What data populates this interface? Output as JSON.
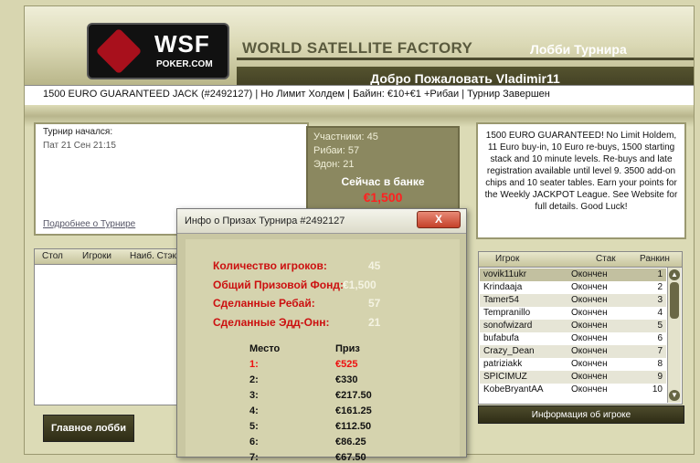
{
  "header": {
    "logo_text": "WSF",
    "logo_sub": "POKER.COM",
    "factory_title": "WORLD SATELLITE FACTORY",
    "lobby_title": "Лобби Турнира",
    "welcome": "Добро Пожаловать Vladimir11"
  },
  "tournament_info": "1500 EURO GUARANTEED JACK (#2492127)  |  Но Лимит Холдем  |  Байин: €10+€1 +Рибаи  |  Турнир Завершен",
  "start_panel": {
    "label": "Турнир начался:",
    "datetime": "Пат 21 Сен 21:15",
    "more_link": "Подробнее о Турнире"
  },
  "stats_panel": {
    "participants": "Участники: 45",
    "rebuys": "Рибаи: 57",
    "addons": "Эдон: 21",
    "pot_label": "Сейчас в банке",
    "pot_value": "€1,500"
  },
  "description": "1500 EURO GUARANTEED! No Limit Holdem, 11 Euro buy-in, 10 Euro re-buys, 1500 starting stack and 10 minute levels. Re-buys and late registration available until level 9. 3500 add-on chips and 10 seater tables. Earn your points for the Weekly JACKPOT League. See Website for full details. Good Luck!",
  "tables_header": {
    "table": "Стол",
    "players": "Игроки",
    "largest": "Наиб. Стэк"
  },
  "players_header": {
    "player": "Игрок",
    "stack": "Стак",
    "rank": "Ранкин"
  },
  "players": [
    {
      "name": "vovik11ukr",
      "status": "Окончен",
      "rank": "1"
    },
    {
      "name": "Krindaaja",
      "status": "Окончен",
      "rank": "2"
    },
    {
      "name": "Tamer54",
      "status": "Окончен",
      "rank": "3"
    },
    {
      "name": "Tempranillo",
      "status": "Окончен",
      "rank": "4"
    },
    {
      "name": "sonofwizard",
      "status": "Окончен",
      "rank": "5"
    },
    {
      "name": "bufabufa",
      "status": "Окончен",
      "rank": "6"
    },
    {
      "name": "Crazy_Dean",
      "status": "Окончен",
      "rank": "7"
    },
    {
      "name": "patriziakk",
      "status": "Окончен",
      "rank": "8"
    },
    {
      "name": "SPICIMUZ",
      "status": "Окончен",
      "rank": "9"
    },
    {
      "name": "KobeBryantAA",
      "status": "Окончен",
      "rank": "10"
    }
  ],
  "buttons": {
    "main_lobby": "Главное лобби",
    "player_info": "Информация об игроке"
  },
  "dialog": {
    "title": "Инфо о Призах Турнира #2492127",
    "close": "X",
    "stats": [
      {
        "label": "Количество игроков:",
        "value": "45"
      },
      {
        "label": "Общий Призовой Фонд:",
        "value": "€1,500"
      },
      {
        "label": "Сделанные Ребай:",
        "value": "57"
      },
      {
        "label": "Сделанные Эдд-Онн:",
        "value": "21"
      }
    ],
    "place_header": "Место",
    "prize_header": "Приз",
    "prizes": [
      {
        "place": "1:",
        "prize": "€525"
      },
      {
        "place": "2:",
        "prize": "€330"
      },
      {
        "place": "3:",
        "prize": "€217.50"
      },
      {
        "place": "4:",
        "prize": "€161.25"
      },
      {
        "place": "5:",
        "prize": "€112.50"
      },
      {
        "place": "6:",
        "prize": "€86.25"
      },
      {
        "place": "7:",
        "prize": "€67.50"
      }
    ]
  }
}
